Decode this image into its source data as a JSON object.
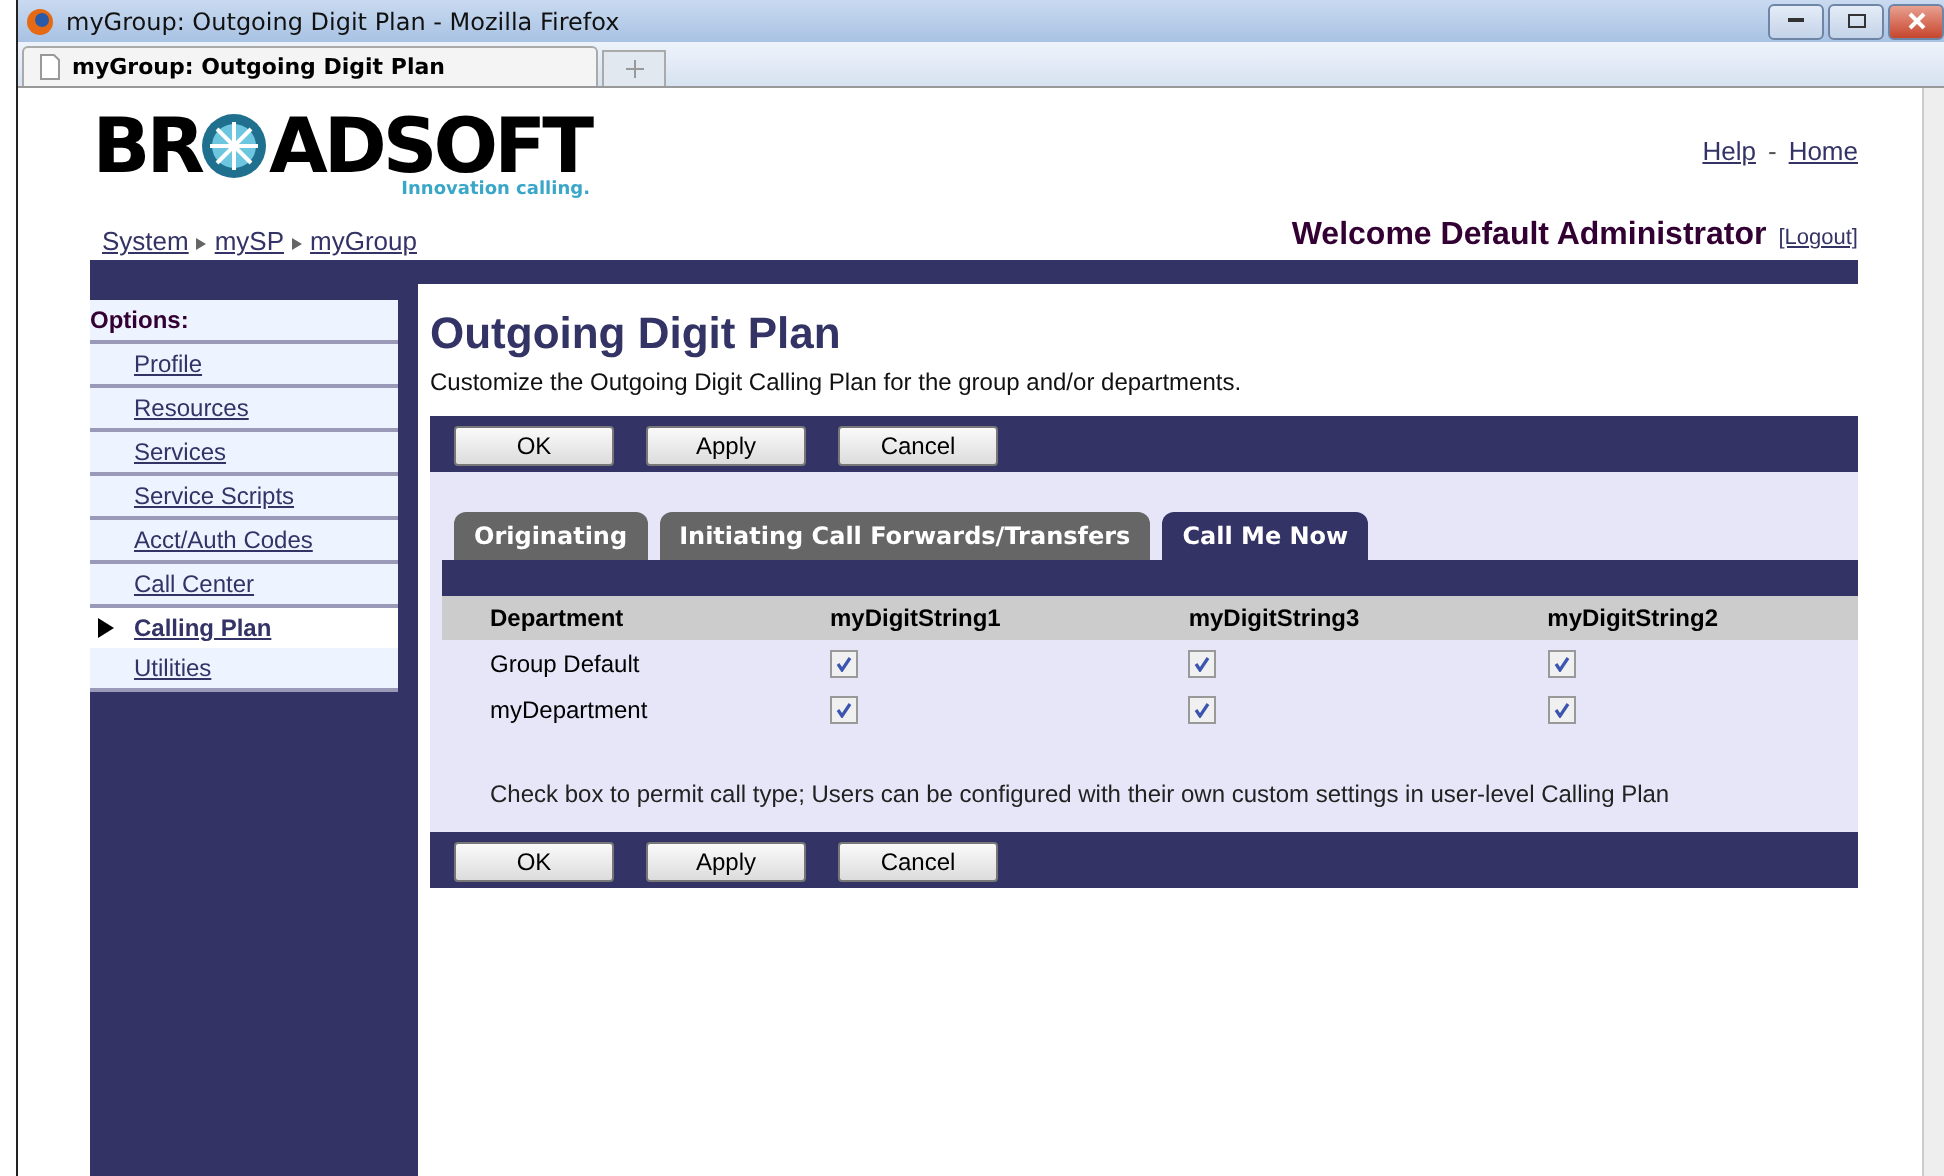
{
  "window": {
    "title": "myGroup: Outgoing Digit Plan - Mozilla Firefox"
  },
  "browser_tab": {
    "title": "myGroup: Outgoing Digit Plan"
  },
  "logo": {
    "left": "BR",
    "right": "ADSOFT",
    "tagline": "Innovation calling."
  },
  "top_links": [
    "Help",
    "-",
    "Home"
  ],
  "breadcrumb": [
    "System",
    "mySP",
    "myGroup"
  ],
  "welcome": {
    "text": "Welcome Default Administrator",
    "logout": "[Logout]"
  },
  "sidebar": {
    "heading": "Options:",
    "items": [
      {
        "label": "Profile",
        "selected": false
      },
      {
        "label": "Resources",
        "selected": false
      },
      {
        "label": "Services",
        "selected": false
      },
      {
        "label": "Service Scripts",
        "selected": false
      },
      {
        "label": "Acct/Auth Codes",
        "selected": false
      },
      {
        "label": "Call Center",
        "selected": false
      },
      {
        "label": "Calling Plan",
        "selected": true
      },
      {
        "label": "Utilities",
        "selected": false
      }
    ]
  },
  "page": {
    "title": "Outgoing Digit Plan",
    "description": "Customize the Outgoing Digit Calling Plan for the group and/or departments."
  },
  "buttons": [
    "OK",
    "Apply",
    "Cancel"
  ],
  "tabs": [
    {
      "label": "Originating",
      "selected": false
    },
    {
      "label": "Initiating Call Forwards/Transfers",
      "selected": false
    },
    {
      "label": "Call Me Now",
      "selected": true
    }
  ],
  "table": {
    "columns": [
      "Department",
      "myDigitString1",
      "myDigitString3",
      "myDigitString2"
    ],
    "rows": [
      {
        "name": "Group Default",
        "checks": [
          true,
          true,
          true
        ]
      },
      {
        "name": "myDepartment",
        "checks": [
          true,
          true,
          true
        ]
      }
    ]
  },
  "note": "Check box to permit call type; Users can be configured with their own custom settings in user-level Calling Plan",
  "bottom_buttons": [
    "OK",
    "Apply",
    "Cancel"
  ]
}
